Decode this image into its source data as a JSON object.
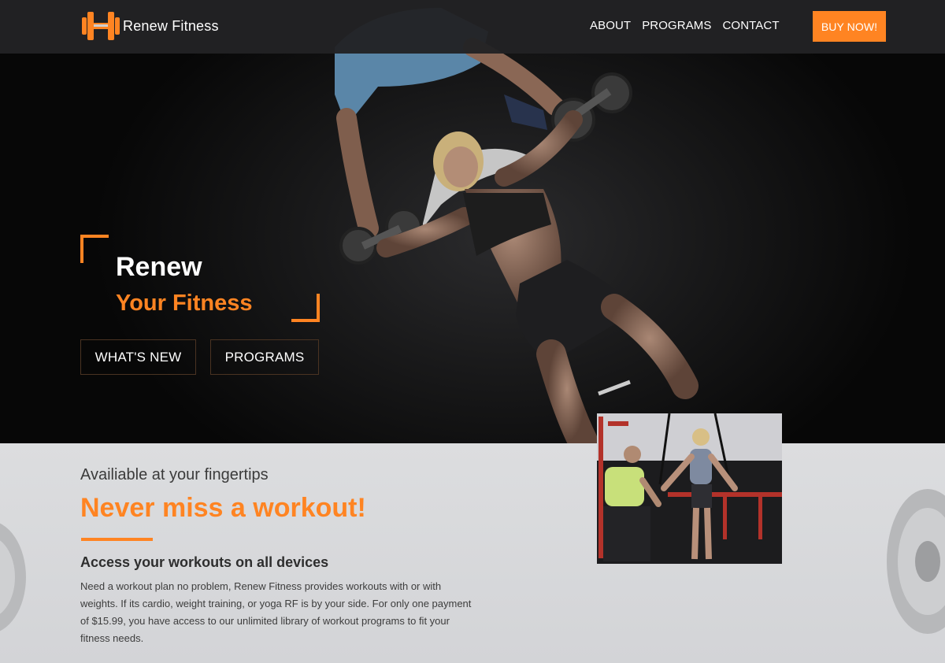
{
  "nav": {
    "brand": "Renew Fitness",
    "links": [
      "ABOUT",
      "PROGRAMS",
      "CONTACT"
    ],
    "buy_label": "BUY NOW!"
  },
  "hero": {
    "title_line1": "Renew",
    "title_line2": "Your Fitness",
    "buttons": [
      "WHAT'S NEW",
      "PROGRAMS"
    ]
  },
  "features": {
    "kicker": "Availiable at your fingertips",
    "heading": "Never miss a workout!",
    "subheading": "Access your workouts on all devices",
    "body": "Need a workout plan no problem, Renew Fitness provides workouts with or with weights. If its cardio, weight training, or yoga RF is by your side. For only one payment of $15.99, you have access to our unlimited library of workout programs to fit your fitness needs."
  },
  "colors": {
    "accent": "#ff8422",
    "nav_bg": "#222224",
    "hero_bg": "#111111",
    "section_bg": "#d8d9db"
  },
  "icons": {
    "logo": "dumbbell-logo-icon"
  }
}
